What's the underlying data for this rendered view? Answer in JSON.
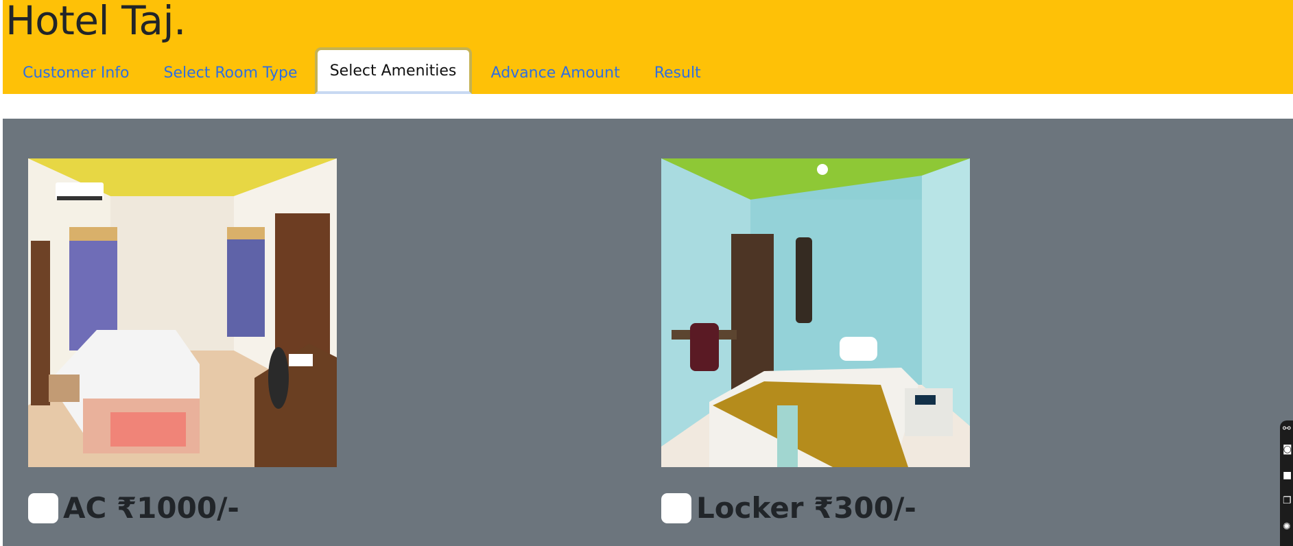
{
  "header": {
    "brand": "Hotel Taj."
  },
  "tabs": [
    {
      "label": "Customer Info",
      "active": false
    },
    {
      "label": "Select Room Type",
      "active": false
    },
    {
      "label": "Select Amenities",
      "active": true
    },
    {
      "label": "Advance Amount",
      "active": false
    },
    {
      "label": "Result",
      "active": false
    }
  ],
  "amenities": [
    {
      "label": "AC ₹1000/-",
      "checked": false,
      "image": "hotel-room-photo"
    },
    {
      "label": "Locker ₹300/-",
      "checked": false,
      "image": "hotel-room-photo"
    }
  ],
  "side_tools": [
    "link-icon",
    "camera-icon",
    "square-icon",
    "copy-icon",
    "gear-icon"
  ],
  "colors": {
    "header_bg": "#fec107",
    "panel_bg": "#6c757d",
    "tab_link": "#2f6fe0"
  }
}
